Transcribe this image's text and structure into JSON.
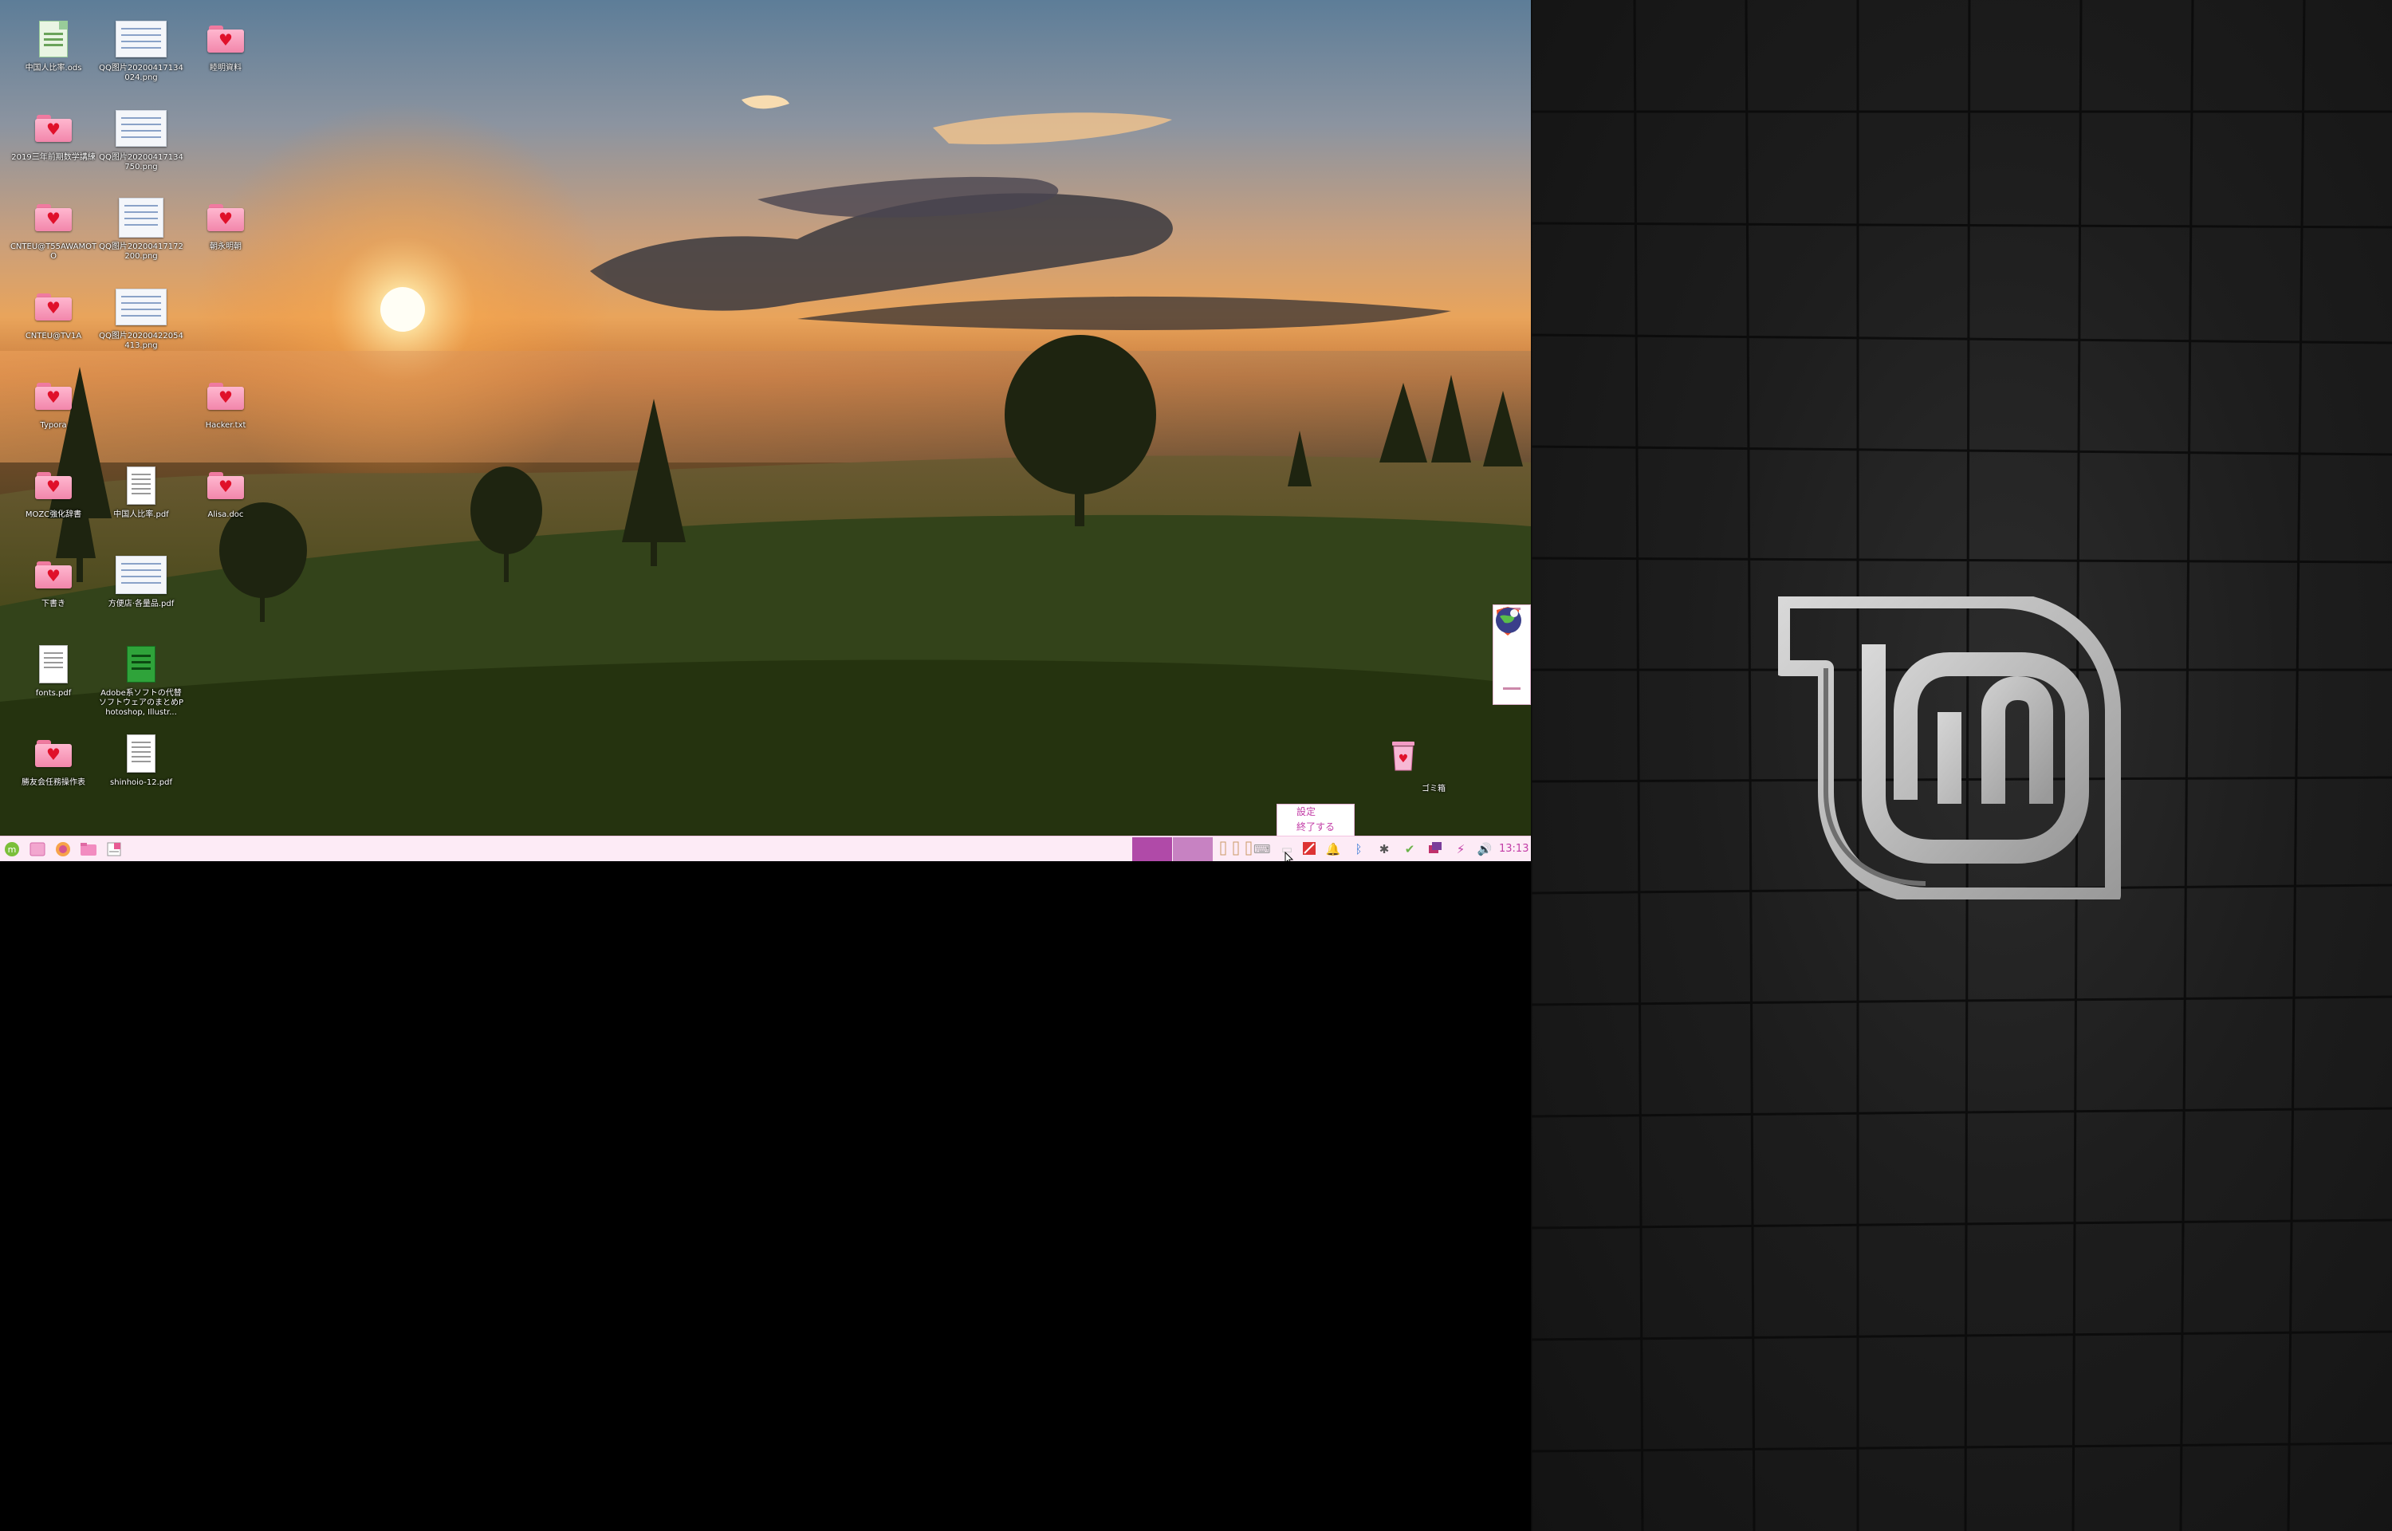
{
  "desktop": {
    "icons": [
      {
        "label": "中国人比率.ods"
      },
      {
        "label": "QQ图片20200417134024.png"
      },
      {
        "label": "睦明資料"
      },
      {
        "label": "2019三年前期数学講練"
      },
      {
        "label": "QQ图片20200417134750.png"
      },
      {
        "label": "CNTEU@T55AWAMOTO"
      },
      {
        "label": "QQ图片20200417172200.png"
      },
      {
        "label": "朝永明朝"
      },
      {
        "label": "CNTEU@TV1A"
      },
      {
        "label": "QQ图片20200422054413.png"
      },
      {
        "label": "Typora"
      },
      {
        "label": "Hacker.txt"
      },
      {
        "label": "MOZC強化辞書"
      },
      {
        "label": "中国人比率.pdf"
      },
      {
        "label": "Alisa.doc"
      },
      {
        "label": "下書き"
      },
      {
        "label": "方便店·各量品.pdf"
      },
      {
        "label": "fonts.pdf"
      },
      {
        "label": "Adobe系ソフトの代替ソフトウェアのまとめPhotoshop, Illustr..."
      },
      {
        "label": "勝友会任務操作表"
      },
      {
        "label": "shinhoio-12.pdf"
      },
      {
        "label": "ゴミ箱"
      }
    ]
  },
  "taskbar": {
    "clock": "13:13",
    "popup_menu": {
      "item_settings": "設定",
      "item_quit": "終了する"
    }
  },
  "colors": {
    "taskbar_bg": "#fdebf6",
    "accent": "#c23ca6",
    "workspace_active": "#b04aa8",
    "workspace_inactive": "#c782c2"
  }
}
